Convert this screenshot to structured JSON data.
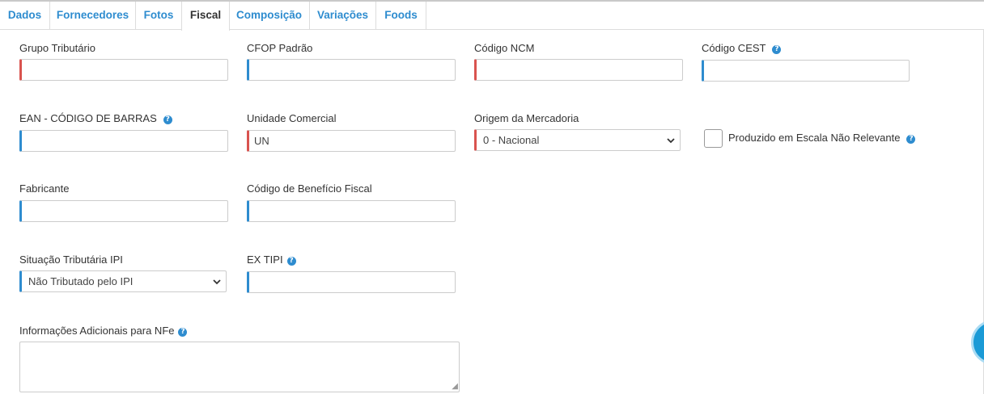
{
  "tabs": [
    {
      "label": "Dados",
      "active": false
    },
    {
      "label": "Fornecedores",
      "active": false
    },
    {
      "label": "Fotos",
      "active": false
    },
    {
      "label": "Fiscal",
      "active": true
    },
    {
      "label": "Composição",
      "active": false
    },
    {
      "label": "Variações",
      "active": false
    },
    {
      "label": "Foods",
      "active": false
    }
  ],
  "fields": {
    "grupo_tributario": {
      "label": "Grupo Tributário",
      "value": ""
    },
    "cfop_padrao": {
      "label": "CFOP Padrão",
      "value": ""
    },
    "codigo_ncm": {
      "label": "Código NCM",
      "value": ""
    },
    "codigo_cest": {
      "label": "Código CEST",
      "value": ""
    },
    "ean": {
      "label": "EAN - CÓDIGO DE BARRAS",
      "value": ""
    },
    "unidade_comercial": {
      "label": "Unidade Comercial",
      "value": "UN"
    },
    "origem_mercadoria": {
      "label": "Origem da Mercadoria",
      "selected": "0 - Nacional"
    },
    "produzido_escala": {
      "label": "Produzido em Escala Não Relevante",
      "checked": false
    },
    "fabricante": {
      "label": "Fabricante",
      "value": ""
    },
    "codigo_beneficio": {
      "label": "Código de Benefício Fiscal",
      "value": ""
    },
    "situacao_ipi": {
      "label": "Situação Tributária IPI",
      "selected": "Não Tributado pelo IPI"
    },
    "ex_tipi": {
      "label": "EX TIPI",
      "value": ""
    },
    "info_adicionais": {
      "label": "Informações Adicionais para NFe",
      "value": ""
    }
  },
  "icons": {
    "help": "question-circle-icon",
    "select": "chevron-down-icon",
    "fab": "floating-action-button"
  },
  "colors": {
    "accent": "#2e8ccf",
    "required": "#d9534f",
    "fab": "#1a9ad6"
  }
}
